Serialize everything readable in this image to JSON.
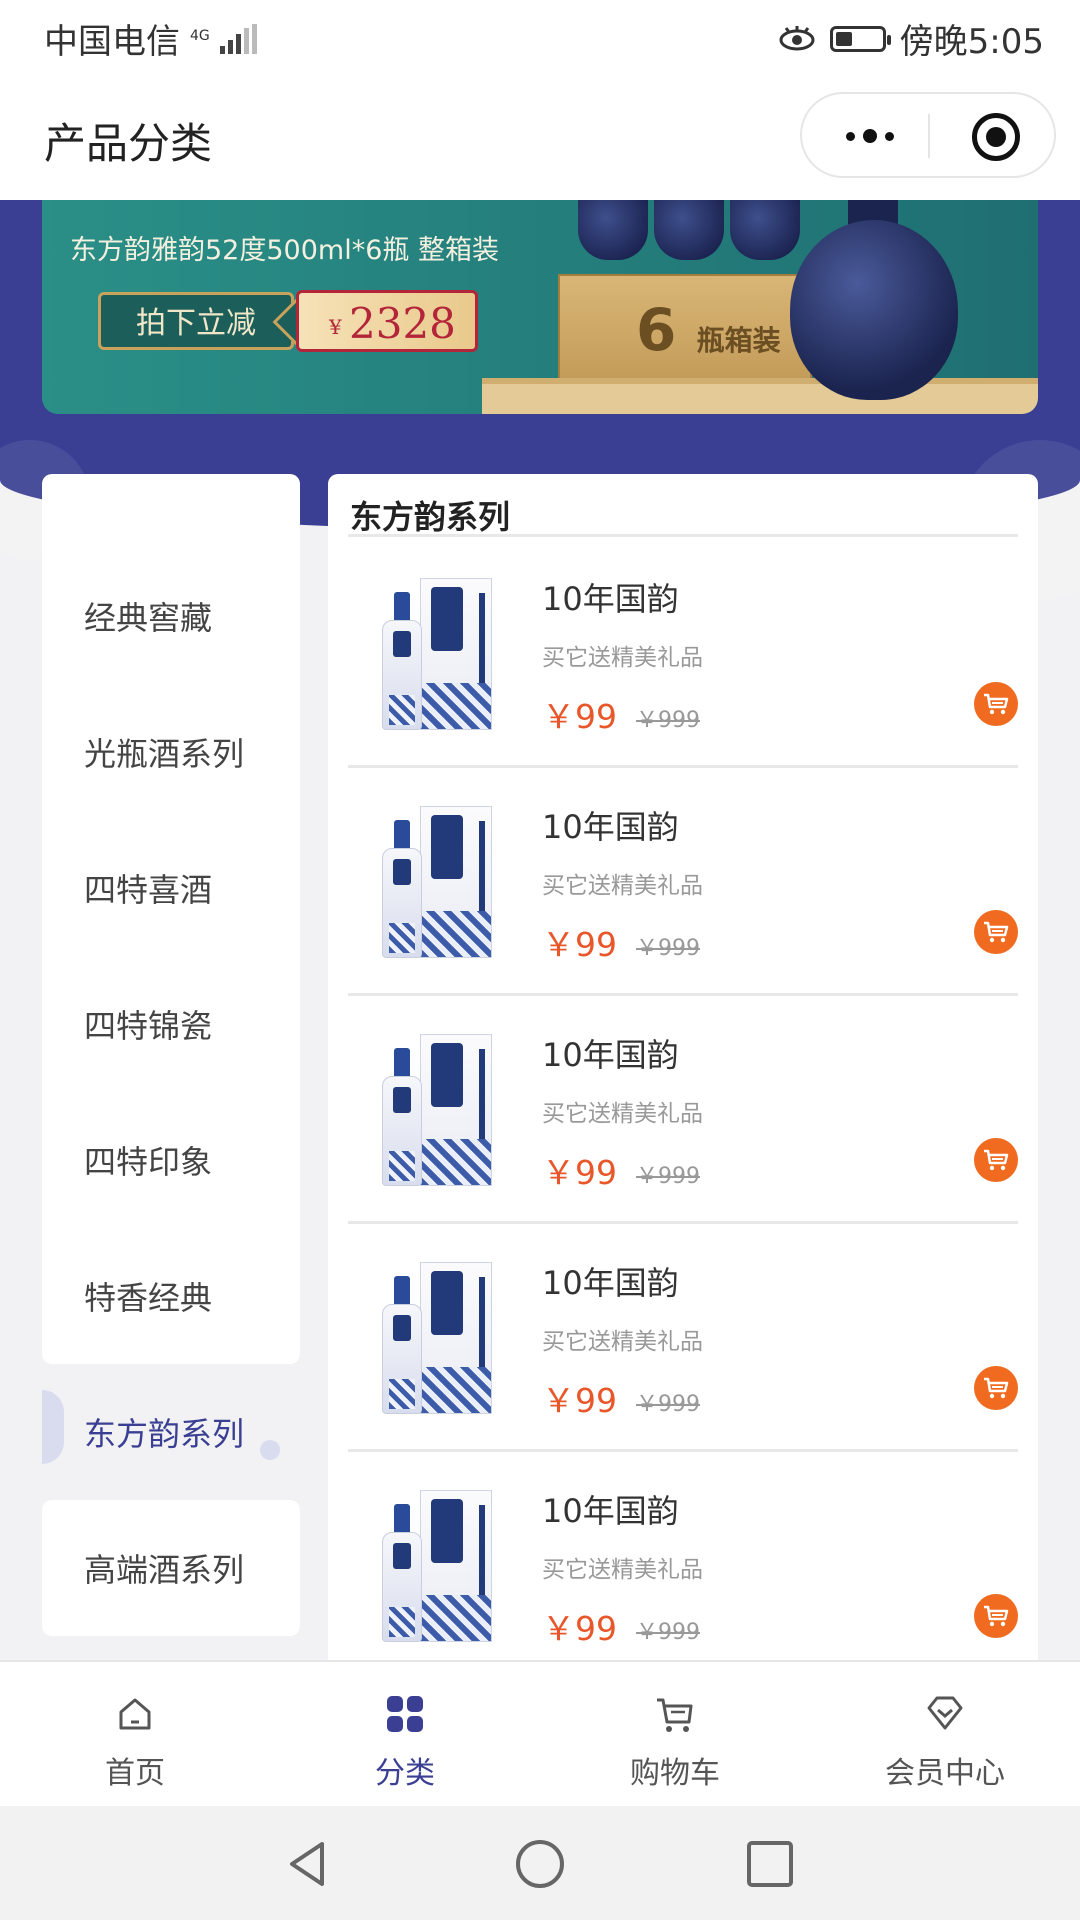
{
  "status_bar": {
    "carrier": "中国电信",
    "network": "4G",
    "time": "傍晚5:05"
  },
  "nav": {
    "title": "产品分类"
  },
  "banner": {
    "headline": "东方韵雅韵52度500ml*6瓶 整箱装",
    "promo_label": "拍下立减",
    "promo_currency": "¥",
    "promo_amount": "2328",
    "crate_number": "6",
    "crate_label": "瓶箱装"
  },
  "sidebar": {
    "items": [
      {
        "label": "经典窖藏",
        "active": false
      },
      {
        "label": "光瓶酒系列",
        "active": false
      },
      {
        "label": "四特喜酒",
        "active": false
      },
      {
        "label": "四特锦瓷",
        "active": false
      },
      {
        "label": "四特印象",
        "active": false
      },
      {
        "label": "特香经典",
        "active": false
      },
      {
        "label": "东方韵系列",
        "active": true
      },
      {
        "label": "高端酒系列",
        "active": false
      }
    ]
  },
  "content": {
    "section_title": "东方韵系列",
    "products": [
      {
        "name": "10年国韵",
        "desc": "买它送精美礼品",
        "price": "￥99",
        "old_price": "￥999"
      },
      {
        "name": "10年国韵",
        "desc": "买它送精美礼品",
        "price": "￥99",
        "old_price": "￥999"
      },
      {
        "name": "10年国韵",
        "desc": "买它送精美礼品",
        "price": "￥99",
        "old_price": "￥999"
      },
      {
        "name": "10年国韵",
        "desc": "买它送精美礼品",
        "price": "￥99",
        "old_price": "￥999"
      },
      {
        "name": "10年国韵",
        "desc": "买它送精美礼品",
        "price": "￥99",
        "old_price": "￥999"
      }
    ]
  },
  "tabbar": {
    "items": [
      {
        "label": "首页",
        "icon": "home-icon",
        "active": false
      },
      {
        "label": "分类",
        "icon": "category-icon",
        "active": true
      },
      {
        "label": "购物车",
        "icon": "cart-icon",
        "active": false
      },
      {
        "label": "会员中心",
        "icon": "member-icon",
        "active": false
      }
    ]
  },
  "colors": {
    "brand": "#3a3f93",
    "price": "#e8572a",
    "cart_button": "#f06a1f"
  }
}
